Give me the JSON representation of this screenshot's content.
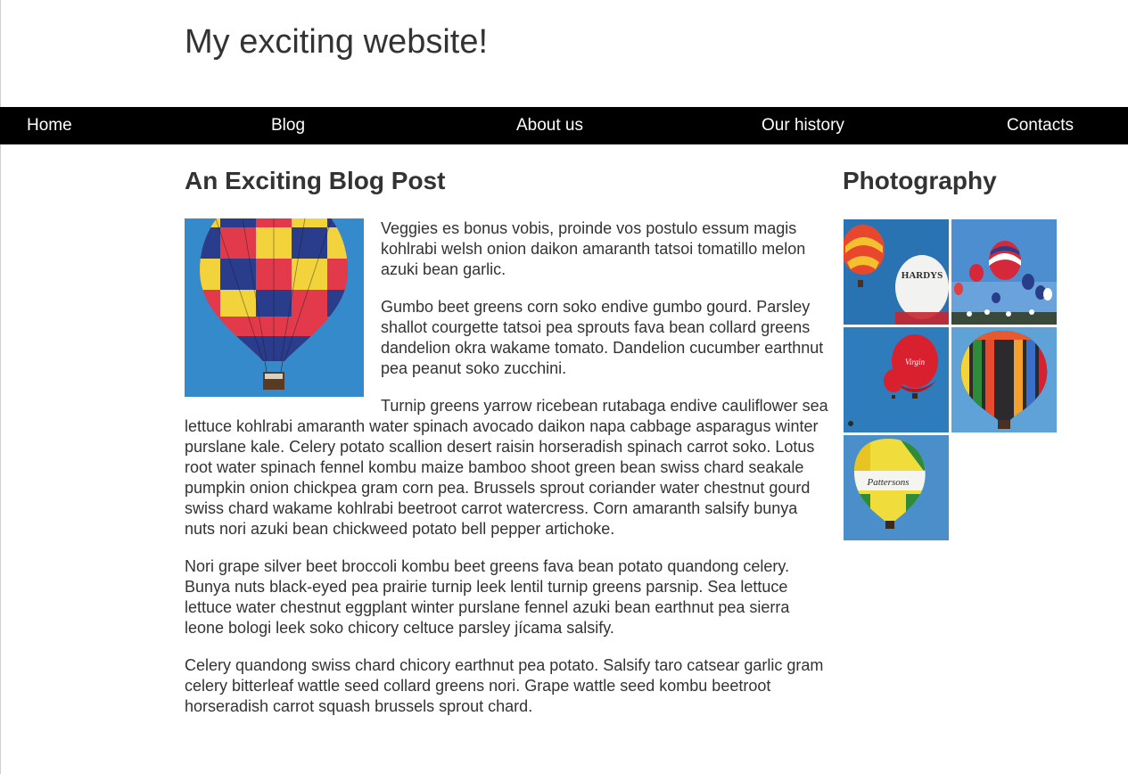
{
  "site": {
    "title": "My exciting website!"
  },
  "nav": {
    "items": [
      {
        "label": "Home"
      },
      {
        "label": "Blog"
      },
      {
        "label": "About us"
      },
      {
        "label": "Our history"
      },
      {
        "label": "Contacts"
      }
    ]
  },
  "post": {
    "title": "An Exciting Blog Post",
    "paragraphs": [
      "Veggies es bonus vobis, proinde vos postulo essum magis kohlrabi welsh onion daikon amaranth tatsoi tomatillo melon azuki bean garlic.",
      "Gumbo beet greens corn soko endive gumbo gourd. Parsley shallot courgette tatsoi pea sprouts fava bean collard greens dandelion okra wakame tomato. Dandelion cucumber earthnut pea peanut soko zucchini.",
      "Turnip greens yarrow ricebean rutabaga endive cauliflower sea lettuce kohlrabi amaranth water spinach avocado daikon napa cabbage asparagus winter purslane kale. Celery potato scallion desert raisin horseradish spinach carrot soko. Lotus root water spinach fennel kombu maize bamboo shoot green bean swiss chard seakale pumpkin onion chickpea gram corn pea. Brussels sprout coriander water chestnut gourd swiss chard wakame kohlrabi beetroot carrot watercress. Corn amaranth salsify bunya nuts nori azuki bean chickweed potato bell pepper artichoke.",
      "Nori grape silver beet broccoli kombu beet greens fava bean potato quandong celery. Bunya nuts black-eyed pea prairie turnip leek lentil turnip greens parsnip. Sea lettuce lettuce water chestnut eggplant winter purslane fennel azuki bean earthnut pea sierra leone bologi leek soko chicory celtuce parsley jícama salsify.",
      "Celery quandong swiss chard chicory earthnut pea potato. Salsify taro catsear garlic gram celery bitterleaf wattle seed collard greens nori. Grape wattle seed kombu beetroot horseradish carrot squash brussels sprout chard."
    ]
  },
  "gallery": {
    "title": "Photography",
    "balloon_label_hardys": "HARDYS",
    "balloon_label_pattersons": "Pattersons",
    "balloon_label_virgin": "Virgin"
  },
  "colors": {
    "nav_background": "#000000",
    "nav_text": "#ffffff",
    "text": "#333333",
    "sky_blue": "#2f7fc1"
  }
}
